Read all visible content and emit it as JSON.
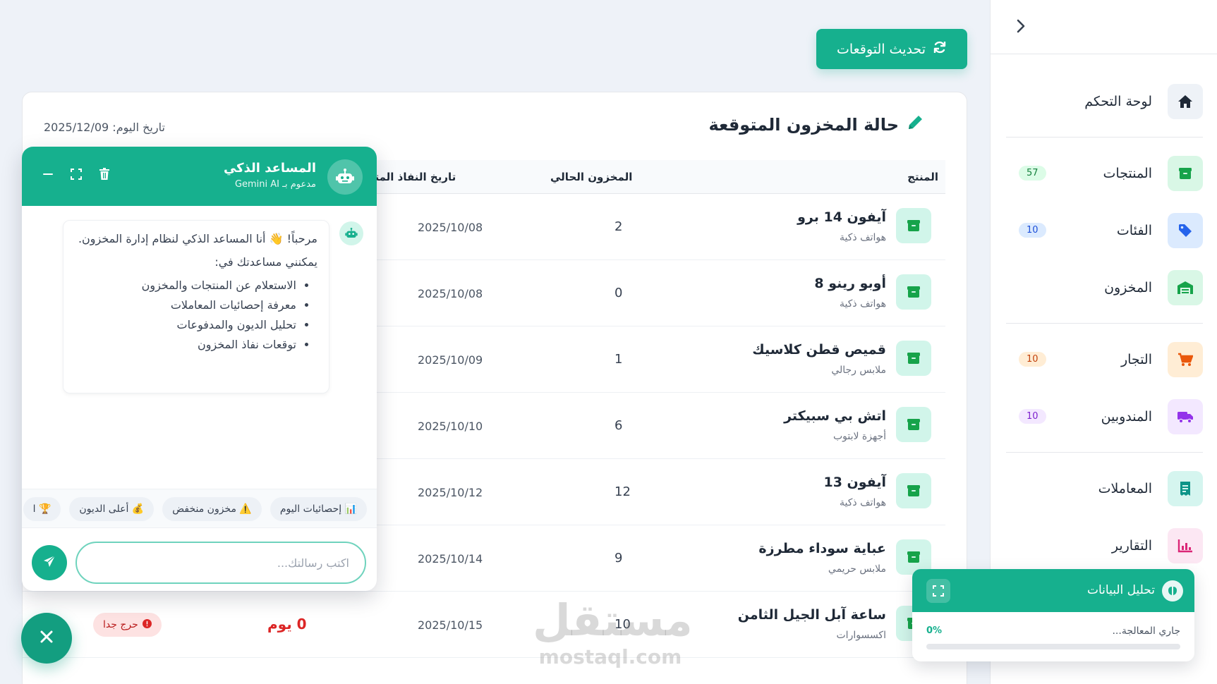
{
  "sidebar": {
    "items": [
      {
        "label": "لوحة التحكم",
        "icon": "home-icon",
        "color": "#1f2937",
        "bg": "#eef2f7",
        "badge": null
      },
      {
        "label": "المنتجات",
        "icon": "box-icon",
        "color": "#16a34a",
        "bg": "#d9f7e6",
        "badge": "57",
        "badge_bg": "#dcfce7",
        "badge_color": "#15803d"
      },
      {
        "label": "الفئات",
        "icon": "tag-icon",
        "color": "#2563eb",
        "bg": "#dbeafe",
        "badge": "10",
        "badge_bg": "#dbeafe",
        "badge_color": "#1d4ed8"
      },
      {
        "label": "المخزون",
        "icon": "warehouse-icon",
        "color": "#16a34a",
        "bg": "#d9f7e6",
        "badge": null
      },
      {
        "label": "التجار",
        "icon": "cart-icon",
        "color": "#ea580c",
        "bg": "#ffedd5",
        "badge": "10",
        "badge_bg": "#ffedd5",
        "badge_color": "#c2410c"
      },
      {
        "label": "المندوبين",
        "icon": "truck-icon",
        "color": "#9333ea",
        "bg": "#f3e8ff",
        "badge": "10",
        "badge_bg": "#f3e8ff",
        "badge_color": "#7e22ce"
      },
      {
        "label": "المعاملات",
        "icon": "receipt-icon",
        "color": "#0d9488",
        "bg": "#d5f5ef",
        "badge": null
      },
      {
        "label": "التقارير",
        "icon": "chart-icon",
        "color": "#db2777",
        "bg": "#fce7f3",
        "badge": null
      }
    ]
  },
  "toolbar": {
    "refresh_label": "تحديث التوقعات"
  },
  "card": {
    "title": "حالة المخزون المتوقعة",
    "date_label": "تاريخ اليوم: 2025/12/09",
    "columns": {
      "product": "المنتج",
      "stock": "المخزون الحالي",
      "date": "تاريخ النفاذ المتوقع"
    }
  },
  "rows": [
    {
      "name": "آيفون 14 برو",
      "category": "هواتف ذكية",
      "stock": "2",
      "date": "2025/10/08"
    },
    {
      "name": "أوبو رينو 8",
      "category": "هواتف ذكية",
      "stock": "0",
      "date": "2025/10/08"
    },
    {
      "name": "قميص قطن كلاسيك",
      "category": "ملابس رجالي",
      "stock": "1",
      "date": "2025/10/09"
    },
    {
      "name": "اتش بي سبيكتر",
      "category": "أجهزة لابتوب",
      "stock": "6",
      "date": "2025/10/10"
    },
    {
      "name": "آيفون 13",
      "category": "هواتف ذكية",
      "stock": "12",
      "date": "2025/10/12"
    },
    {
      "name": "عباية سوداء مطرزة",
      "category": "ملابس حريمي",
      "stock": "9",
      "date": "2025/10/14"
    },
    {
      "name": "ساعة آبل الجيل الثامن",
      "category": "اكسسوارات",
      "stock": "10",
      "date": "2025/10/15",
      "days": "0 يوم",
      "status": "حرج جدا"
    }
  ],
  "chat": {
    "title": "المساعد الذكي",
    "subtitle": "مدعوم بـ Gemini AI",
    "greeting": "مرحباً! 👋 أنا المساعد الذكي لنظام إدارة المخزون.",
    "intro": "يمكنني مساعدتك في:",
    "bullets": [
      "الاستعلام عن المنتجات والمخزون",
      "معرفة إحصائيات المعاملات",
      "تحليل الديون والمدفوعات",
      "توقعات نفاذ المخزون"
    ],
    "chips": [
      "📊 إحصائيات اليوم",
      "⚠️ مخزون منخفض",
      "💰 أعلى الديون",
      "🏆 ا"
    ],
    "input_placeholder": "اكتب رسالتك..."
  },
  "analysis": {
    "title": "تحليل البيانات",
    "status": "جاري المعالجة...",
    "percent_label": "0%",
    "progress": 0
  },
  "watermark": {
    "main": "مستقل",
    "sub": "mostaql.com"
  }
}
